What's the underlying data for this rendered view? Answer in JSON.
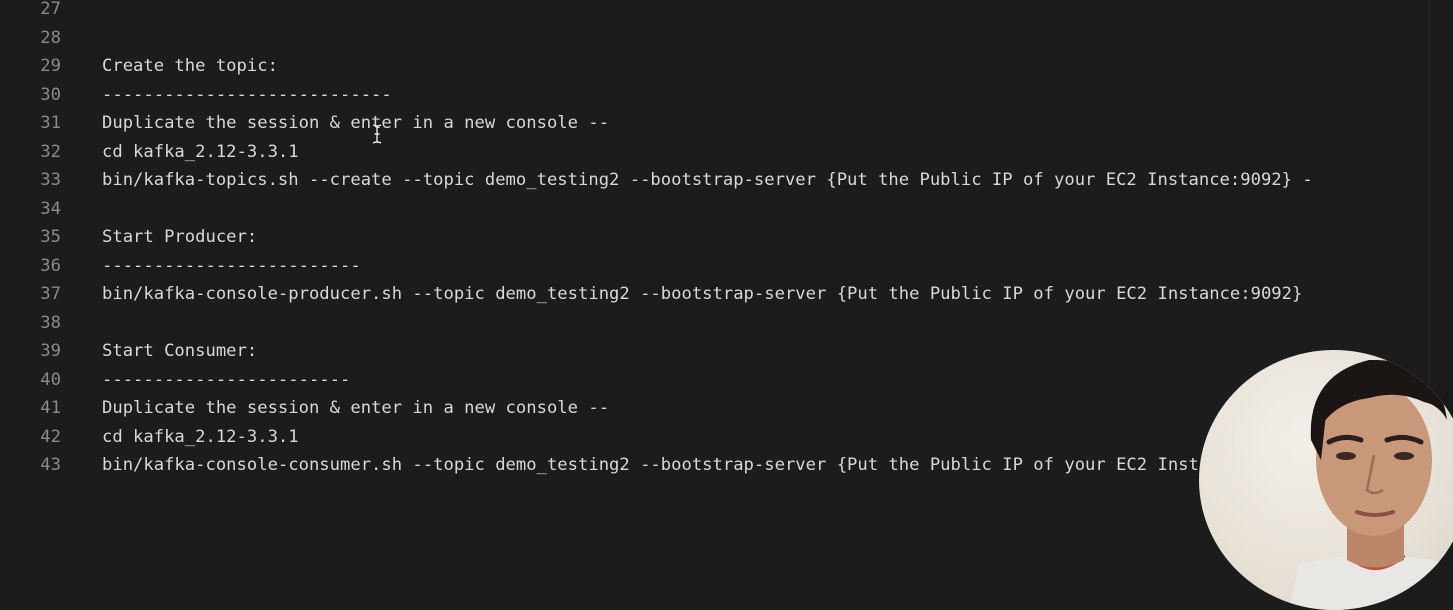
{
  "editor": {
    "lines": [
      {
        "num": "27",
        "text": ""
      },
      {
        "num": "28",
        "text": ""
      },
      {
        "num": "29",
        "text": "Create the topic:"
      },
      {
        "num": "30",
        "text": "----------------------------"
      },
      {
        "num": "31",
        "text": "Duplicate the session & enter in a new console --"
      },
      {
        "num": "32",
        "text": "cd kafka_2.12-3.3.1"
      },
      {
        "num": "33",
        "text": "bin/kafka-topics.sh --create --topic demo_testing2 --bootstrap-server {Put the Public IP of your EC2 Instance:9092} -"
      },
      {
        "num": "34",
        "text": ""
      },
      {
        "num": "35",
        "text": "Start Producer:"
      },
      {
        "num": "36",
        "text": "-------------------------"
      },
      {
        "num": "37",
        "text": "bin/kafka-console-producer.sh --topic demo_testing2 --bootstrap-server {Put the Public IP of your EC2 Instance:9092}"
      },
      {
        "num": "38",
        "text": ""
      },
      {
        "num": "39",
        "text": "Start Consumer:"
      },
      {
        "num": "40",
        "text": "------------------------"
      },
      {
        "num": "41",
        "text": "Duplicate the session & enter in a new console --"
      },
      {
        "num": "42",
        "text": "cd kafka_2.12-3.3.1"
      },
      {
        "num": "43",
        "text": "bin/kafka-console-consumer.sh --topic demo_testing2 --bootstrap-server {Put the Public IP of your EC2 Instance:9092}"
      }
    ]
  },
  "cursor": {
    "icon": "text-cursor-icon"
  },
  "webcam": {
    "icon": "presenter-webcam-overlay"
  },
  "colors": {
    "background": "#1c1c1c",
    "text": "#d8d8d8",
    "line_numbers": "#8a8a8a"
  }
}
